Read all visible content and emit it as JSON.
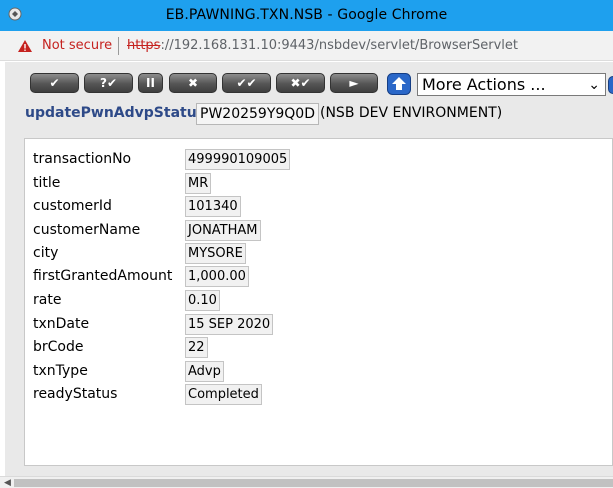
{
  "window": {
    "title": "EB.PAWNING.TXN.NSB - Google Chrome"
  },
  "addressbar": {
    "security_label": "Not secure",
    "url_scheme": "https",
    "url_rest": "://192.168.131.10:9443/nsbdev/servlet/BrowserServlet"
  },
  "toolbar": {
    "buttons": [
      {
        "icon": "check-icon",
        "label": "✔"
      },
      {
        "icon": "validate-icon",
        "label": "?✔"
      },
      {
        "icon": "hold-icon",
        "label": "II"
      },
      {
        "icon": "delete-icon",
        "label": "✖"
      },
      {
        "icon": "authorise-icon",
        "label": "✔✔"
      },
      {
        "icon": "reverse-icon",
        "label": "✖✔"
      },
      {
        "icon": "next-icon",
        "label": "►"
      }
    ],
    "actions_selected": "More Actions ..."
  },
  "transaction": {
    "name": "updatePwnAdvpStatus",
    "id": "PW20259Y9Q0D",
    "environment": "(NSB DEV ENVIRONMENT)"
  },
  "fields": [
    {
      "label": "transactionNo",
      "value": "499990109005"
    },
    {
      "label": "title",
      "value": "MR"
    },
    {
      "label": "customerId",
      "value": "101340"
    },
    {
      "label": "customerName",
      "value": "JONATHAM"
    },
    {
      "label": "city",
      "value": "MYSORE"
    },
    {
      "label": "firstGrantedAmount",
      "value": "1,000.00"
    },
    {
      "label": "rate",
      "value": "0.10"
    },
    {
      "label": "txnDate",
      "value": "15 SEP 2020"
    },
    {
      "label": "brCode",
      "value": "22"
    },
    {
      "label": "txnType",
      "value": "Advp"
    },
    {
      "label": "readyStatus",
      "value": "Completed"
    }
  ]
}
